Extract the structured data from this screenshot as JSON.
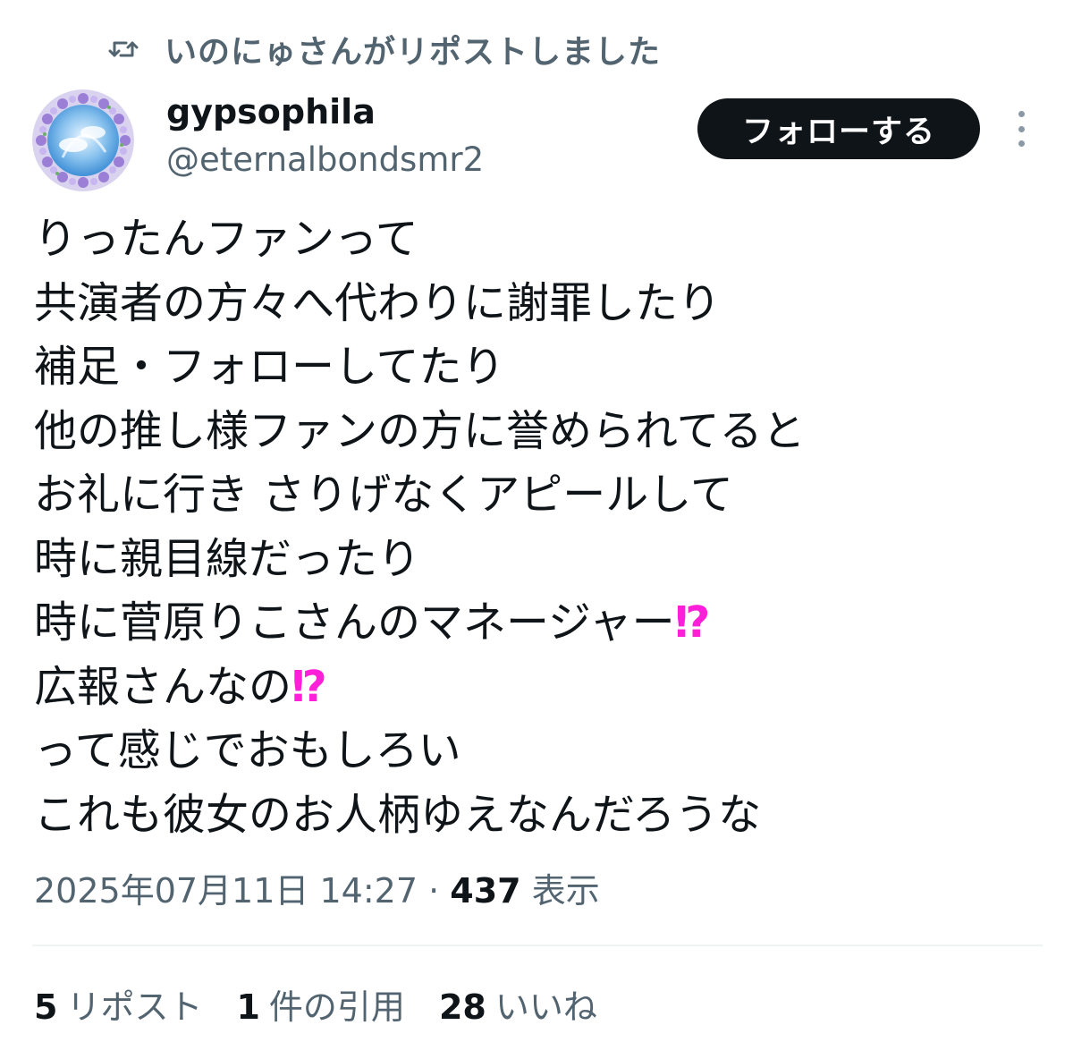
{
  "repost_header": {
    "icon": "repost-icon",
    "text": "いのにゅさんがリポストしました"
  },
  "author": {
    "display_name": "gypsophila",
    "handle": "@eternalbondsmr2",
    "avatar_icon": "avatar-flower-wreath"
  },
  "follow_button_label": "フォローする",
  "more_icon": "more-vertical-icon",
  "tweet": {
    "lines": [
      "りったんファンって",
      "共演者の方々へ代わりに謝罪したり",
      "補足・フォローしてたり",
      "他の推し様ファンの方に誉められてると",
      "お礼に行き さりげなくアピールして",
      "時に親目線だったり",
      "時に菅原りこさんのマネージャー",
      "広報さんなの",
      "って感じでおもしろい",
      "これも彼女のお人柄ゆえなんだろうな"
    ],
    "interrobang": "⁉"
  },
  "meta": {
    "timestamp": "2025年07月11日 14:27",
    "separator": "·",
    "views_count": "437",
    "views_label": "表示"
  },
  "stats": {
    "reposts_count": "5",
    "reposts_label": "リポスト",
    "quotes_count": "1",
    "quotes_label": "件の引用",
    "likes_count": "28",
    "likes_label": "いいね"
  },
  "colors": {
    "text_primary": "#0f1419",
    "text_secondary": "#536471",
    "button_bg": "#0f1419",
    "interrobang": "#ff1fd8",
    "divider": "#eff3f4"
  }
}
